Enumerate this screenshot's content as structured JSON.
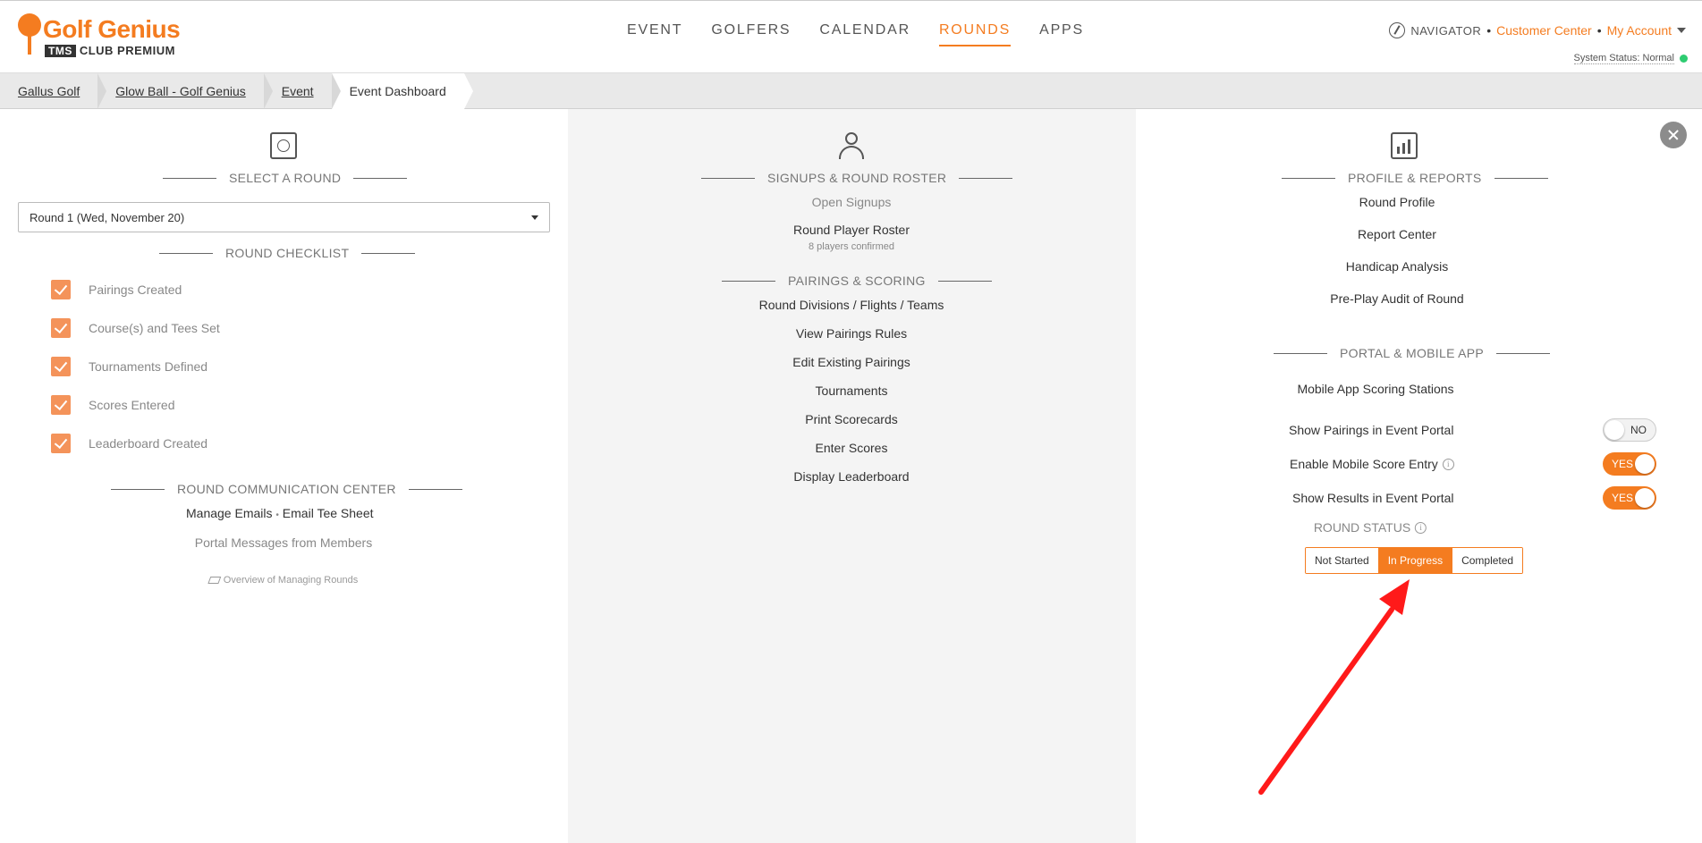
{
  "header": {
    "logo_name": "Golf Genius",
    "logo_tms": "TMS",
    "logo_sub": "CLUB PREMIUM",
    "nav": [
      "EVENT",
      "GOLFERS",
      "CALENDAR",
      "ROUNDS",
      "APPS"
    ],
    "active_nav": "ROUNDS",
    "navigator_label": "NAVIGATOR",
    "customer_center": "Customer Center",
    "my_account": "My Account",
    "separator": "•",
    "system_status": "System Status: Normal"
  },
  "breadcrumb": [
    "Gallus Golf",
    "Glow Ball - Golf Genius",
    "Event",
    "Event Dashboard"
  ],
  "left": {
    "select_title": "SELECT A ROUND",
    "round_value": "Round 1 (Wed, November 20)",
    "checklist_title": "ROUND CHECKLIST",
    "checklist": [
      "Pairings Created",
      "Course(s) and Tees Set",
      "Tournaments Defined",
      "Scores Entered",
      "Leaderboard Created"
    ],
    "comm_title": "ROUND COMMUNICATION CENTER",
    "manage_emails": "Manage Emails",
    "email_sep": "•",
    "email_tee_sheet": "Email Tee Sheet",
    "portal_messages": "Portal Messages from Members",
    "overview": "Overview of Managing Rounds"
  },
  "middle": {
    "signups_title": "SIGNUPS & ROUND ROSTER",
    "open_signups": "Open Signups",
    "player_roster": "Round Player Roster",
    "players_confirmed": "8 players confirmed",
    "pairings_title": "PAIRINGS & SCORING",
    "links": [
      "Round Divisions / Flights / Teams",
      "View Pairings Rules",
      "Edit Existing Pairings",
      "Tournaments",
      "Print Scorecards",
      "Enter Scores",
      "Display Leaderboard"
    ]
  },
  "right": {
    "profile_title": "PROFILE & REPORTS",
    "profile_links": [
      "Round Profile",
      "Report Center",
      "Handicap Analysis",
      "Pre-Play Audit of Round"
    ],
    "portal_title": "PORTAL & MOBILE APP",
    "scoring_stations": "Mobile App Scoring Stations",
    "toggles": [
      {
        "label": "Show Pairings in Event Portal",
        "state": "NO",
        "info": false
      },
      {
        "label": "Enable Mobile Score Entry",
        "state": "YES",
        "info": true
      },
      {
        "label": "Show Results in Event Portal",
        "state": "YES",
        "info": true
      }
    ],
    "info_glyph": "i",
    "status_title": "ROUND STATUS",
    "status_options": [
      "Not Started",
      "In Progress",
      "Completed"
    ],
    "status_selected": "In Progress"
  },
  "colors": {
    "accent": "#f47c20",
    "annotation_arrow": "#ff1a1a"
  }
}
